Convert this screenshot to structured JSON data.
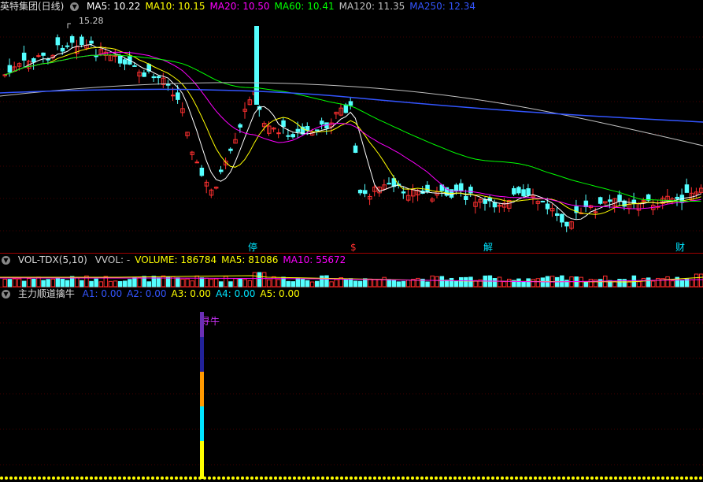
{
  "price_panel": {
    "title": "英特集团(日线)",
    "ma": [
      {
        "label": "MA5: 10.22",
        "color": "#ffffff"
      },
      {
        "label": "MA10: 10.15",
        "color": "#ffff00"
      },
      {
        "label": "MA20: 10.50",
        "color": "#ff00ff"
      },
      {
        "label": "MA60: 10.41",
        "color": "#00ff00"
      },
      {
        "label": "MA120: 11.35",
        "color": "#c0c0c0"
      },
      {
        "label": "MA250: 12.34",
        "color": "#3355ff"
      }
    ],
    "high_label": "15.28",
    "events": [
      {
        "text": "停",
        "color": "#00e5ff"
      },
      {
        "text": "$",
        "color": "#ff3030"
      },
      {
        "text": "解",
        "color": "#00e5ff"
      },
      {
        "text": "财",
        "color": "#00e5ff"
      }
    ]
  },
  "volume_panel": {
    "title": "VOL-TDX(5,10)",
    "items": [
      {
        "label": "VVOL: -",
        "color": "#cccccc"
      },
      {
        "label": "VOLUME: 186784",
        "color": "#ffff00"
      },
      {
        "label": "MA5: 81086",
        "color": "#ffff00"
      },
      {
        "label": "MA10: 55672",
        "color": "#ff00ff"
      }
    ]
  },
  "indicator_panel": {
    "title": "主力顺道擒牛",
    "items": [
      {
        "label": "A1: 0.00",
        "color": "#3355ff"
      },
      {
        "label": "A2: 0.00",
        "color": "#3355ff"
      },
      {
        "label": "A3: 0.00",
        "color": "#ffff00"
      },
      {
        "label": "A4: 0.00",
        "color": "#00e5ff"
      },
      {
        "label": "A5: 0.00",
        "color": "#ffff00"
      }
    ],
    "signal_text": "寻牛",
    "signal_color": "#cc33ff"
  },
  "colors": {
    "up": "#ff3030",
    "down": "#54ffff",
    "separator": "#a00000"
  }
}
